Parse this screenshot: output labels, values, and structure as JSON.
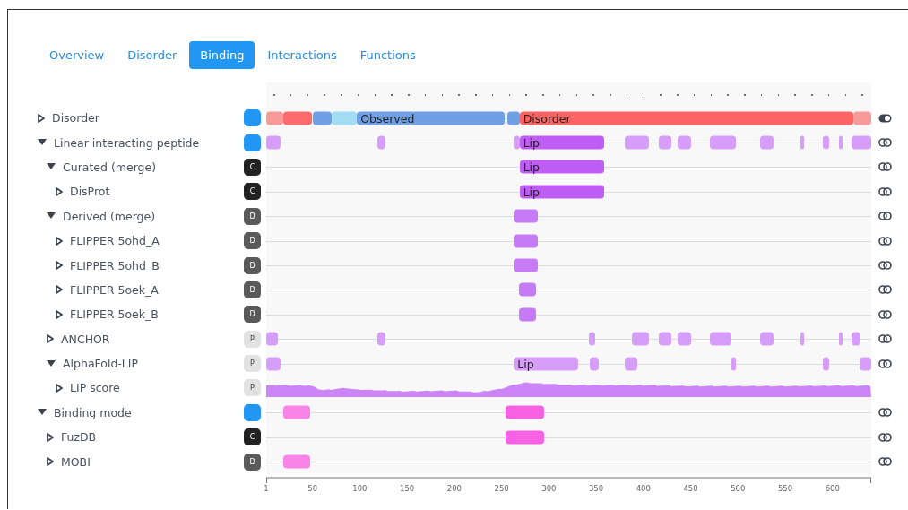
{
  "tabs": [
    {
      "label": "Overview",
      "selected": false
    },
    {
      "label": "Disorder",
      "selected": false
    },
    {
      "label": "Binding",
      "selected": true
    },
    {
      "label": "Interactions",
      "selected": false
    },
    {
      "label": "Functions",
      "selected": false
    }
  ],
  "tracks": [
    {
      "label": "Disorder",
      "expanded": false,
      "badge": {
        "kind": "group"
      },
      "kind": "segments",
      "toggle": {
        "on": true
      },
      "segments": [
        {
          "color": "#f79a9a"
        },
        {
          "color": "#ff6b6b"
        },
        {
          "color": "#6f9fe4"
        },
        {
          "color": "#a3dcf5"
        },
        {
          "color": "#6f9fe4",
          "label": "Observed"
        },
        {
          "color": "#6f9fe4"
        },
        {
          "color": "#ff6464",
          "label": "Disorder"
        },
        {
          "color": "#f79a9a"
        }
      ]
    },
    {
      "label": "Linear interacting peptide",
      "expanded": true,
      "badge": {
        "kind": "group"
      },
      "kind": "segments",
      "toggle": {
        "on": false
      },
      "segments": [
        {
          "color": "#d69ef8"
        },
        {
          "color": "#d69ef8"
        },
        {
          "color": "#d69ef8"
        },
        {
          "color": "#bf5ef5",
          "label": "Lip"
        },
        {
          "color": "#d69ef8"
        },
        {
          "color": "#d69ef8"
        },
        {
          "color": "#d69ef8"
        },
        {
          "color": "#d69ef8"
        },
        {
          "color": "#d69ef8"
        },
        {
          "color": "#d69ef8"
        },
        {
          "color": "#d69ef8"
        },
        {
          "color": "#d69ef8"
        },
        {
          "color": "#d69ef8"
        }
      ],
      "children": [
        {
          "label": "Curated (merge)",
          "expanded": true,
          "badge": {
            "kind": "curated",
            "text": "C"
          },
          "kind": "segments",
          "toggle": {
            "on": false
          },
          "segments": [
            {
              "color": "#bf5ef5",
              "label": "Lip"
            }
          ],
          "children": [
            {
              "label": "DisProt",
              "expanded": false,
              "badge": {
                "kind": "curated",
                "text": "C"
              },
              "kind": "segments",
              "toggle": {
                "on": false
              },
              "segments": [
                {
                  "color": "#bf5ef5",
                  "label": "Lip"
                }
              ]
            }
          ]
        },
        {
          "label": "Derived (merge)",
          "expanded": true,
          "badge": {
            "kind": "derived",
            "text": "D"
          },
          "kind": "segments",
          "toggle": {
            "on": false
          },
          "segments": [
            {
              "color": "#c77af5"
            }
          ],
          "children": [
            {
              "label": "FLIPPER 5ohd_A",
              "expanded": false,
              "badge": {
                "kind": "derived",
                "text": "D"
              },
              "kind": "segments",
              "toggle": {
                "on": false
              },
              "segments": [
                {
                  "color": "#c77af5"
                }
              ]
            },
            {
              "label": "FLIPPER 5ohd_B",
              "expanded": false,
              "badge": {
                "kind": "derived",
                "text": "D"
              },
              "kind": "segments",
              "toggle": {
                "on": false
              },
              "segments": [
                {
                  "color": "#c77af5"
                }
              ]
            },
            {
              "label": "FLIPPER 5oek_A",
              "expanded": false,
              "badge": {
                "kind": "derived",
                "text": "D"
              },
              "kind": "segments",
              "toggle": {
                "on": false
              },
              "segments": [
                {
                  "color": "#c77af5"
                }
              ]
            },
            {
              "label": "FLIPPER 5oek_B",
              "expanded": false,
              "badge": {
                "kind": "derived",
                "text": "D"
              },
              "kind": "segments",
              "toggle": {
                "on": false
              },
              "segments": [
                {
                  "color": "#c77af5"
                }
              ]
            }
          ]
        },
        {
          "label": "ANCHOR",
          "expanded": false,
          "badge": {
            "kind": "predicted",
            "text": "P"
          },
          "kind": "segments",
          "toggle": {
            "on": false
          },
          "segments": [
            {
              "color": "#d69ef8"
            },
            {
              "color": "#d69ef8"
            },
            {
              "color": "#d69ef8"
            },
            {
              "color": "#d69ef8"
            },
            {
              "color": "#d69ef8"
            },
            {
              "color": "#d69ef8"
            },
            {
              "color": "#d69ef8"
            },
            {
              "color": "#d69ef8"
            },
            {
              "color": "#d69ef8"
            },
            {
              "color": "#d69ef8"
            },
            {
              "color": "#d69ef8"
            }
          ]
        },
        {
          "label": "AlphaFold-LIP",
          "expanded": true,
          "badge": {
            "kind": "predicted",
            "text": "P"
          },
          "kind": "segments",
          "toggle": {
            "on": false
          },
          "segments": [
            {
              "color": "#d69ef8"
            },
            {
              "color": "#d69ef8",
              "label": "Lip"
            },
            {
              "color": "#d69ef8"
            },
            {
              "color": "#d69ef8"
            },
            {
              "color": "#d69ef8"
            },
            {
              "color": "#d69ef8"
            },
            {
              "color": "#d69ef8"
            }
          ],
          "children": [
            {
              "label": "LIP score",
              "expanded": false,
              "badge": {
                "kind": "predicted",
                "text": "P"
              },
              "kind": "profile"
            }
          ]
        }
      ]
    },
    {
      "label": "Binding mode",
      "expanded": true,
      "badge": {
        "kind": "group"
      },
      "kind": "segments",
      "toggle": {
        "on": false
      },
      "segments": [
        {
          "color": "#f984e8"
        },
        {
          "color": "#f762e4"
        }
      ],
      "children": [
        {
          "label": "FuzDB",
          "expanded": false,
          "badge": {
            "kind": "curated",
            "text": "C"
          },
          "kind": "segments",
          "toggle": {
            "on": false
          },
          "segments": [
            {
              "color": "#f762e4"
            }
          ]
        },
        {
          "label": "MOBI",
          "expanded": false,
          "badge": {
            "kind": "derived",
            "text": "D"
          },
          "kind": "segments",
          "toggle": {
            "on": false
          },
          "segments": [
            {
              "color": "#f984e8"
            }
          ]
        }
      ]
    }
  ],
  "axis": {
    "ticks": [
      "1",
      "50",
      "100",
      "150",
      "200",
      "250",
      "300",
      "350",
      "400",
      "450",
      "500",
      "550",
      "600"
    ]
  }
}
